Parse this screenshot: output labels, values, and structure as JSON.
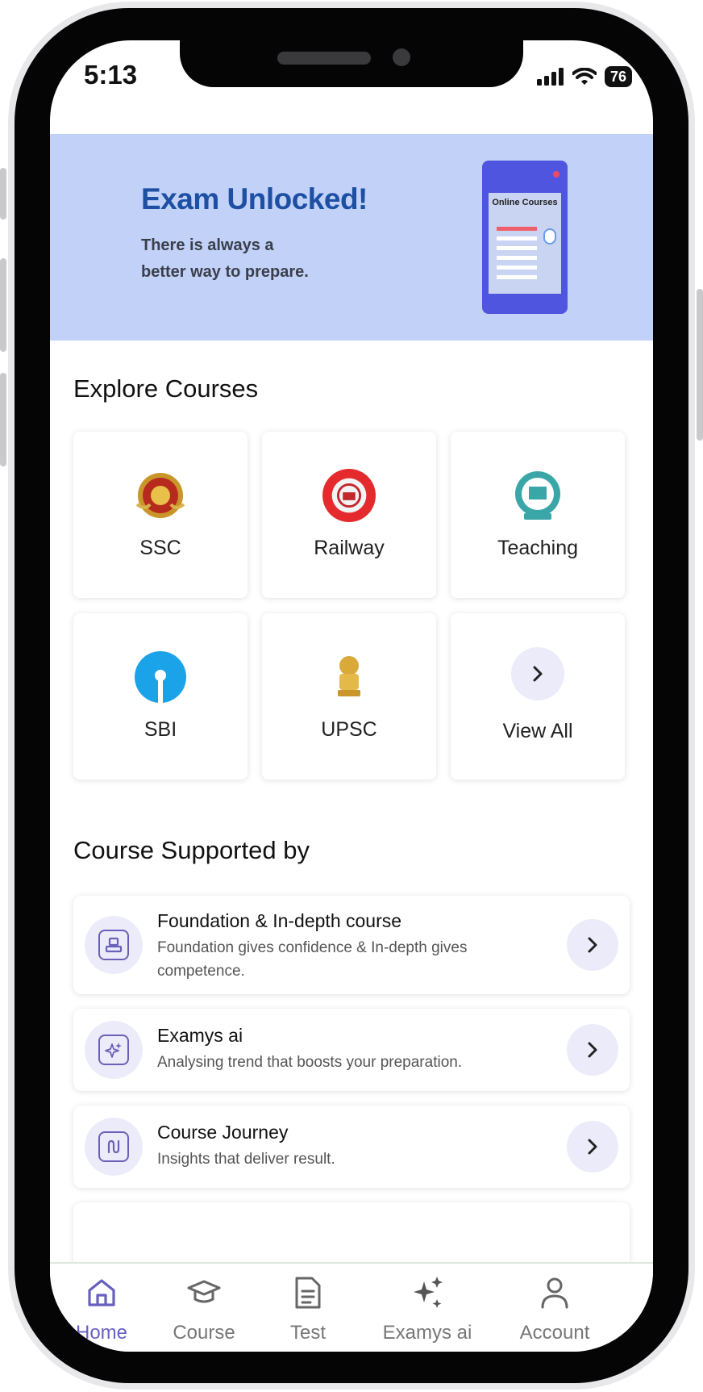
{
  "status_bar": {
    "time": "5:13",
    "battery": "76"
  },
  "banner": {
    "title": "Exam Unlocked!",
    "subtitle_line1": "There is always a",
    "subtitle_line2": "better way to prepare.",
    "illustration_caption": "Online Courses"
  },
  "explore": {
    "title": "Explore Courses",
    "tiles": [
      {
        "label": "SSC",
        "icon": "ssc-emblem-icon"
      },
      {
        "label": "Railway",
        "icon": "railway-emblem-icon"
      },
      {
        "label": "Teaching",
        "icon": "teaching-emblem-icon"
      },
      {
        "label": "SBI",
        "icon": "sbi-logo-icon"
      },
      {
        "label": "UPSC",
        "icon": "national-emblem-icon"
      },
      {
        "label": "View All",
        "icon": "chevron-right-icon"
      }
    ]
  },
  "supported": {
    "title": "Course Supported by",
    "cards": [
      {
        "title": "Foundation & In-depth course",
        "desc": "Foundation gives confidence & In-depth gives competence.",
        "icon": "foundation-icon"
      },
      {
        "title": "Examys ai",
        "desc": "Analysing trend that boosts your preparation.",
        "icon": "sparkle-icon"
      },
      {
        "title": "Course Journey",
        "desc": "Insights that deliver result.",
        "icon": "journey-path-icon"
      }
    ]
  },
  "nav": {
    "items": [
      {
        "label": "Home",
        "icon": "home-icon",
        "active": true
      },
      {
        "label": "Course",
        "icon": "graduation-cap-icon",
        "active": false
      },
      {
        "label": "Test",
        "icon": "document-icon",
        "active": false
      },
      {
        "label": "Examys ai",
        "icon": "sparkle-icon",
        "active": false
      },
      {
        "label": "Account",
        "icon": "user-icon",
        "active": false
      }
    ]
  },
  "colors": {
    "accent": "#6860c0",
    "banner_bg": "#c1d1f8",
    "banner_title": "#1d4fa3",
    "icon_bg": "#ecebfa"
  }
}
